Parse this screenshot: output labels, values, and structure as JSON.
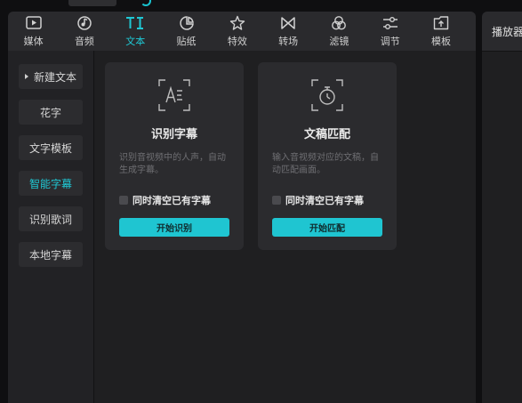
{
  "app": {
    "accent_color": "#1fc8d4"
  },
  "toolbar": {
    "items": [
      {
        "label": "媒体",
        "icon": "media-icon",
        "active": false
      },
      {
        "label": "音频",
        "icon": "audio-icon",
        "active": false
      },
      {
        "label": "文本",
        "icon": "text-icon",
        "active": true
      },
      {
        "label": "贴纸",
        "icon": "sticker-icon",
        "active": false
      },
      {
        "label": "特效",
        "icon": "effects-icon",
        "active": false
      },
      {
        "label": "转场",
        "icon": "transition-icon",
        "active": false
      },
      {
        "label": "滤镜",
        "icon": "filter-icon",
        "active": false
      },
      {
        "label": "调节",
        "icon": "adjust-icon",
        "active": false
      },
      {
        "label": "模板",
        "icon": "template-icon",
        "active": false
      }
    ]
  },
  "sidebar": {
    "items": [
      {
        "label": "新建文本",
        "active": false,
        "expandable": true
      },
      {
        "label": "花字",
        "active": false
      },
      {
        "label": "文字模板",
        "active": false
      },
      {
        "label": "智能字幕",
        "active": true
      },
      {
        "label": "识别歌词",
        "active": false
      },
      {
        "label": "本地字幕",
        "active": false
      }
    ]
  },
  "cards": [
    {
      "icon": "speech-recognition-icon",
      "title": "识别字幕",
      "description": "识别音视频中的人声，自动生成字幕。",
      "checkbox_label": "同时清空已有字幕",
      "checked": false,
      "button_label": "开始识别"
    },
    {
      "icon": "text-match-timer-icon",
      "title": "文稿匹配",
      "description": "输入音视频对应的文稿，自动匹配画面。",
      "checkbox_label": "同时清空已有字幕",
      "checked": false,
      "button_label": "开始匹配"
    }
  ],
  "player": {
    "title": "播放器"
  }
}
